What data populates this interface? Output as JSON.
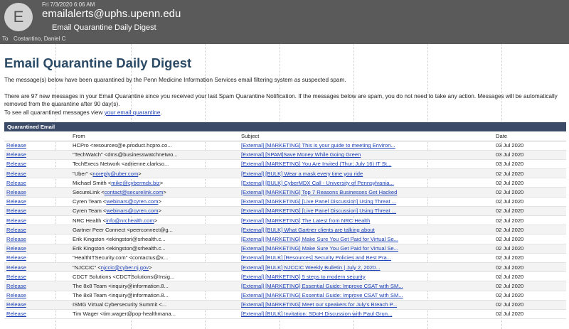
{
  "mail": {
    "avatar_letter": "E",
    "date": "Fri 7/3/2020 6:06 AM",
    "from": "emailalerts@uphs.upenn.edu",
    "subject": "Email Quarantine Daily Digest",
    "to_label": "To",
    "to": "Costantino, Daniel C"
  },
  "body": {
    "title": "Email Quarantine Daily Digest",
    "intro": "The message(s) below have been quarantined by the Penn Medicine Information Services email filtering system as suspected spam.",
    "notice": "There are 97 new messages in your Email Quarantine since you received your last Spam Quarantine Notification. If the messages below are spam, you do not need to take any action. Messages will be automatically removed from the quarantine after 90 day(s).",
    "view_prefix": "To see all quarantined messages view ",
    "view_link": "your email quarantine",
    "view_suffix": "."
  },
  "table": {
    "caption": "Quarantined Email",
    "headers": {
      "release": "",
      "from": "From",
      "subject": "Subject",
      "date": "Date"
    },
    "rows": [
      {
        "release": "Release",
        "from_text": "HCPro <resources@e.product.hcpro.co...",
        "from_link": "",
        "subject": "[External] [MARKETING] This is your guide to meeting Environ...",
        "date": "03 Jul 2020"
      },
      {
        "release": "Release",
        "from_text": "\"TechWatch\" <dms@businesswatchnetwo...",
        "from_link": "",
        "subject": "[External] [SPAM]Save Money While Going Green",
        "date": "03 Jul 2020"
      },
      {
        "release": "Release",
        "from_text": "TechExecs Network <adrienne.clarkso...",
        "from_link": "",
        "subject": "[External] [MARKETING] You Are Invited (Thur, July 16) IT St...",
        "date": "03 Jul 2020"
      },
      {
        "release": "Release",
        "from_text": "\"Uber\" <",
        "from_link": "noreply@uber.com",
        "from_after": ">",
        "subject": "[External] [BULK] Wear a mask every time you ride",
        "date": "02 Jul 2020"
      },
      {
        "release": "Release",
        "from_text": "Michael Smith <",
        "from_link": "mike@cybermdx.biz",
        "from_after": ">",
        "subject": "[External] [BULK] CyberMDX Call - University of Pennsylvania...",
        "date": "02 Jul 2020"
      },
      {
        "release": "Release",
        "from_text": "SecureLink <",
        "from_link": "contact@securelink.com",
        "from_after": ">",
        "subject": "[External] [MARKETING] Top 7 Reasons Businesses Get Hacked",
        "date": "02 Jul 2020"
      },
      {
        "release": "Release",
        "from_text": "Cyren Team <",
        "from_link": "webinars@cyren.com",
        "from_after": ">",
        "subject": "[External] [MARKETING] [Live Panel Discussion] Using Threat ...",
        "date": "02 Jul 2020"
      },
      {
        "release": "Release",
        "from_text": "Cyren Team <",
        "from_link": "webinars@cyren.com",
        "from_after": ">",
        "subject": "[External] [MARKETING] [Live Panel Discussion] Using Threat ...",
        "date": "02 Jul 2020"
      },
      {
        "release": "Release",
        "from_text": "NRC Health <",
        "from_link": "info@nrchealth.com",
        "from_after": ">",
        "subject": "[External] [MARKETING] The Latest from NRC Health",
        "date": "02 Jul 2020"
      },
      {
        "release": "Release",
        "from_text": "Gartner Peer Connect <peerconnect@g...",
        "from_link": "",
        "subject": "[External] [BULK] What Gartner clients are talking about",
        "date": "02 Jul 2020"
      },
      {
        "release": "Release",
        "from_text": "Erik Kingston <ekingston@srhealth.c...",
        "from_link": "",
        "subject": "[External] [MARKETING] Make Sure You Get Paid for Virtual Se...",
        "date": "02 Jul 2020"
      },
      {
        "release": "Release",
        "from_text": "Erik Kingston <ekingston@srhealth.c...",
        "from_link": "",
        "subject": "[External] [MARKETING] Make Sure You Get Paid for Virtual Se...",
        "date": "02 Jul 2020"
      },
      {
        "release": "Release",
        "from_text": "\"HealthITSecurity.com\" <contactus@x...",
        "from_link": "",
        "subject": "[External] [BULK] [Resources] Security Policies and Best Pra...",
        "date": "02 Jul 2020"
      },
      {
        "release": "Release",
        "from_text": "\"NJCCIC\" <",
        "from_link": "njccic@cyber.nj.gov",
        "from_after": ">",
        "subject": "[External] [BULK] NJCCIC Weekly Bulletin | July 2, 2020...",
        "date": "02 Jul 2020"
      },
      {
        "release": "Release",
        "from_text": "CDCT Solutions <CDCTSolutions@Insig...",
        "from_link": "",
        "subject": "[External] [MARKETING] 5 steps to modern security",
        "date": "02 Jul 2020"
      },
      {
        "release": "Release",
        "from_text": "The 8x8 Team <inquiry@information.8...",
        "from_link": "",
        "subject": "[External] [MARKETING] Essential Guide: Improve CSAT with SM...",
        "date": "02 Jul 2020"
      },
      {
        "release": "Release",
        "from_text": "The 8x8 Team <inquiry@information.8...",
        "from_link": "",
        "subject": "[External] [MARKETING] Essential Guide: Improve CSAT with SM...",
        "date": "02 Jul 2020"
      },
      {
        "release": "Release",
        "from_text": "ISMG Virtual Cybersecurity Summit <...",
        "from_link": "",
        "subject": "[External] [MARKETING] Meet our speakers for July's Breach P...",
        "date": "02 Jul 2020"
      },
      {
        "release": "Release",
        "from_text": "Tim Wager <tim.wager@pop-healthmana...",
        "from_link": "",
        "subject": "[External] [BULK] Invitation: SDoH Discussion with Paul Grun...",
        "date": "02 Jul 2020"
      }
    ]
  },
  "colors": {
    "header_bg": "#5a5a5a",
    "title": "#2b4a66",
    "caption_bg": "#3b4a67",
    "link": "#1a3fb5"
  }
}
